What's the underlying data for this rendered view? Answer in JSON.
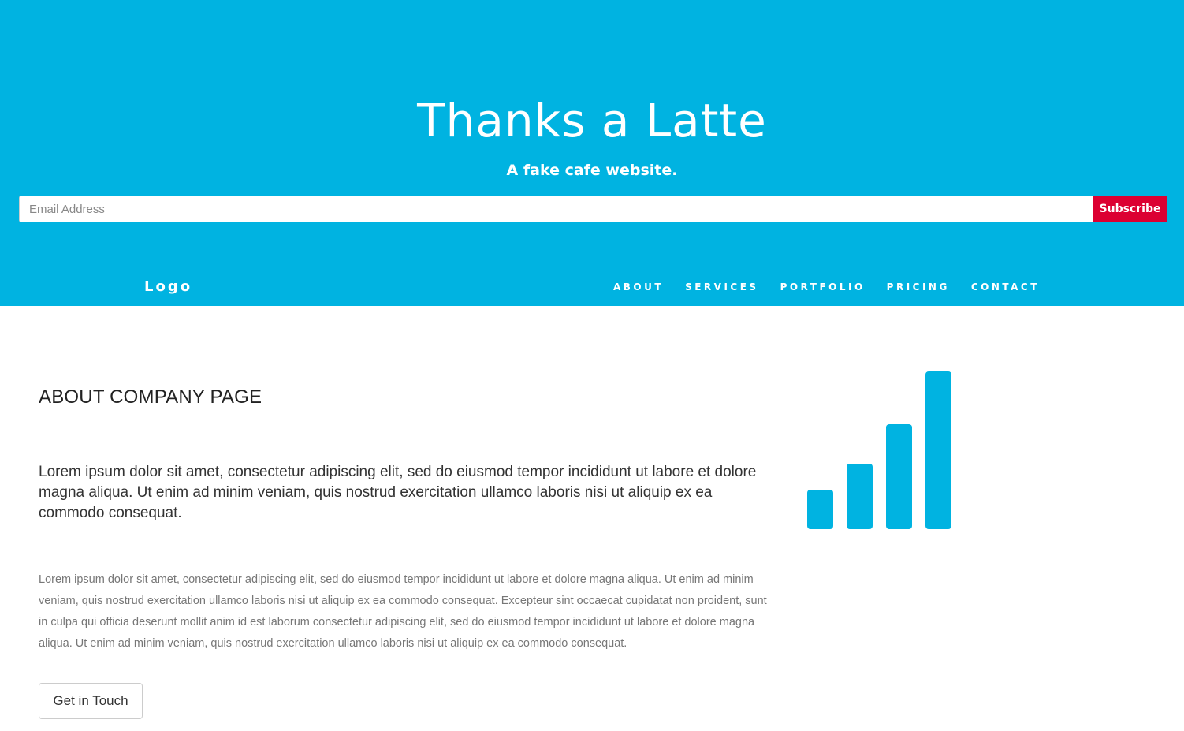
{
  "hero": {
    "title": "Thanks a Latte",
    "subtitle": "A fake cafe website.",
    "background_color": "#00b3e1"
  },
  "subscribe": {
    "email_placeholder": "Email Address",
    "email_value": "",
    "button_label": "Subscribe",
    "button_color": "#dc0032"
  },
  "nav": {
    "logo": "Logo",
    "links": [
      {
        "label": "ABOUT"
      },
      {
        "label": "SERVICES"
      },
      {
        "label": "PORTFOLIO"
      },
      {
        "label": "PRICING"
      },
      {
        "label": "CONTACT"
      }
    ]
  },
  "about": {
    "heading": "ABOUT COMPANY PAGE",
    "lead": "Lorem ipsum dolor sit amet, consectetur adipiscing elit, sed do eiusmod tempor incididunt ut labore et dolore magna aliqua. Ut enim ad minim veniam, quis nostrud exercitation ullamco laboris nisi ut aliquip ex ea commodo consequat.",
    "body": "Lorem ipsum dolor sit amet, consectetur adipiscing elit, sed do eiusmod tempor incididunt ut labore et dolore magna aliqua. Ut enim ad minim veniam, quis nostrud exercitation ullamco laboris nisi ut aliquip ex ea commodo consequat. Excepteur sint occaecat cupidatat non proident, sunt in culpa qui officia deserunt mollit anim id est laborum consectetur adipiscing elit, sed do eiusmod tempor incididunt ut labore et dolore magna aliqua. Ut enim ad minim veniam, quis nostrud exercitation ullamco laboris nisi ut aliquip ex ea commodo consequat.",
    "button_label": "Get in Touch"
  },
  "icons": {
    "feature_icon": "signal-bars-icon",
    "feature_icon_color": "#00b3e1"
  }
}
